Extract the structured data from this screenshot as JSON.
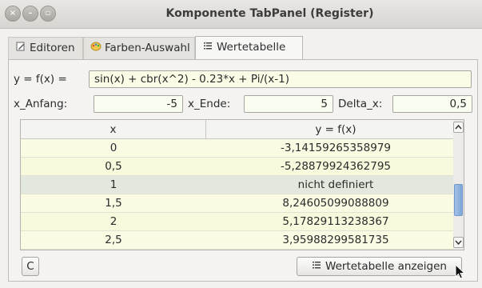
{
  "window": {
    "title": "Komponente TabPanel (Register)",
    "controls": [
      "×",
      "–",
      "▫"
    ]
  },
  "tabs": [
    {
      "label": "Editoren",
      "icon": "edit-icon"
    },
    {
      "label": "Farben-Auswahl",
      "icon": "palette-icon"
    },
    {
      "label": "Wertetabelle",
      "icon": "list-icon",
      "active": true
    }
  ],
  "function": {
    "label": "y = f(x) =",
    "value": "sin(x) + cbr(x^2) - 0.23*x + Pi/(x-1)"
  },
  "range": {
    "start_label": "x_Anfang:",
    "start_value": "-5",
    "end_label": "x_Ende:",
    "end_value": "5",
    "delta_label": "Delta_x:",
    "delta_value": "0,5"
  },
  "table": {
    "headers": [
      "x",
      "y = f(x)"
    ],
    "rows": [
      [
        "0",
        "-3,14159265358979"
      ],
      [
        "0,5",
        "-5,28879924362795"
      ],
      [
        "1",
        "nicht definiert"
      ],
      [
        "1,5",
        "8,24605099088809"
      ],
      [
        "2",
        "5,17829113238367"
      ],
      [
        "2,5",
        "3,95988299581735"
      ]
    ],
    "selected_row": 2,
    "scroll_position": 0.55
  },
  "buttons": {
    "clear": "C",
    "show_table": "Wertetabelle anzeigen"
  },
  "colors": {
    "input_background": "#fbfbe6",
    "row_background": "#fbfbe4",
    "selected_row": "#e3e8de",
    "scroll_thumb": "#7ea6d8"
  }
}
